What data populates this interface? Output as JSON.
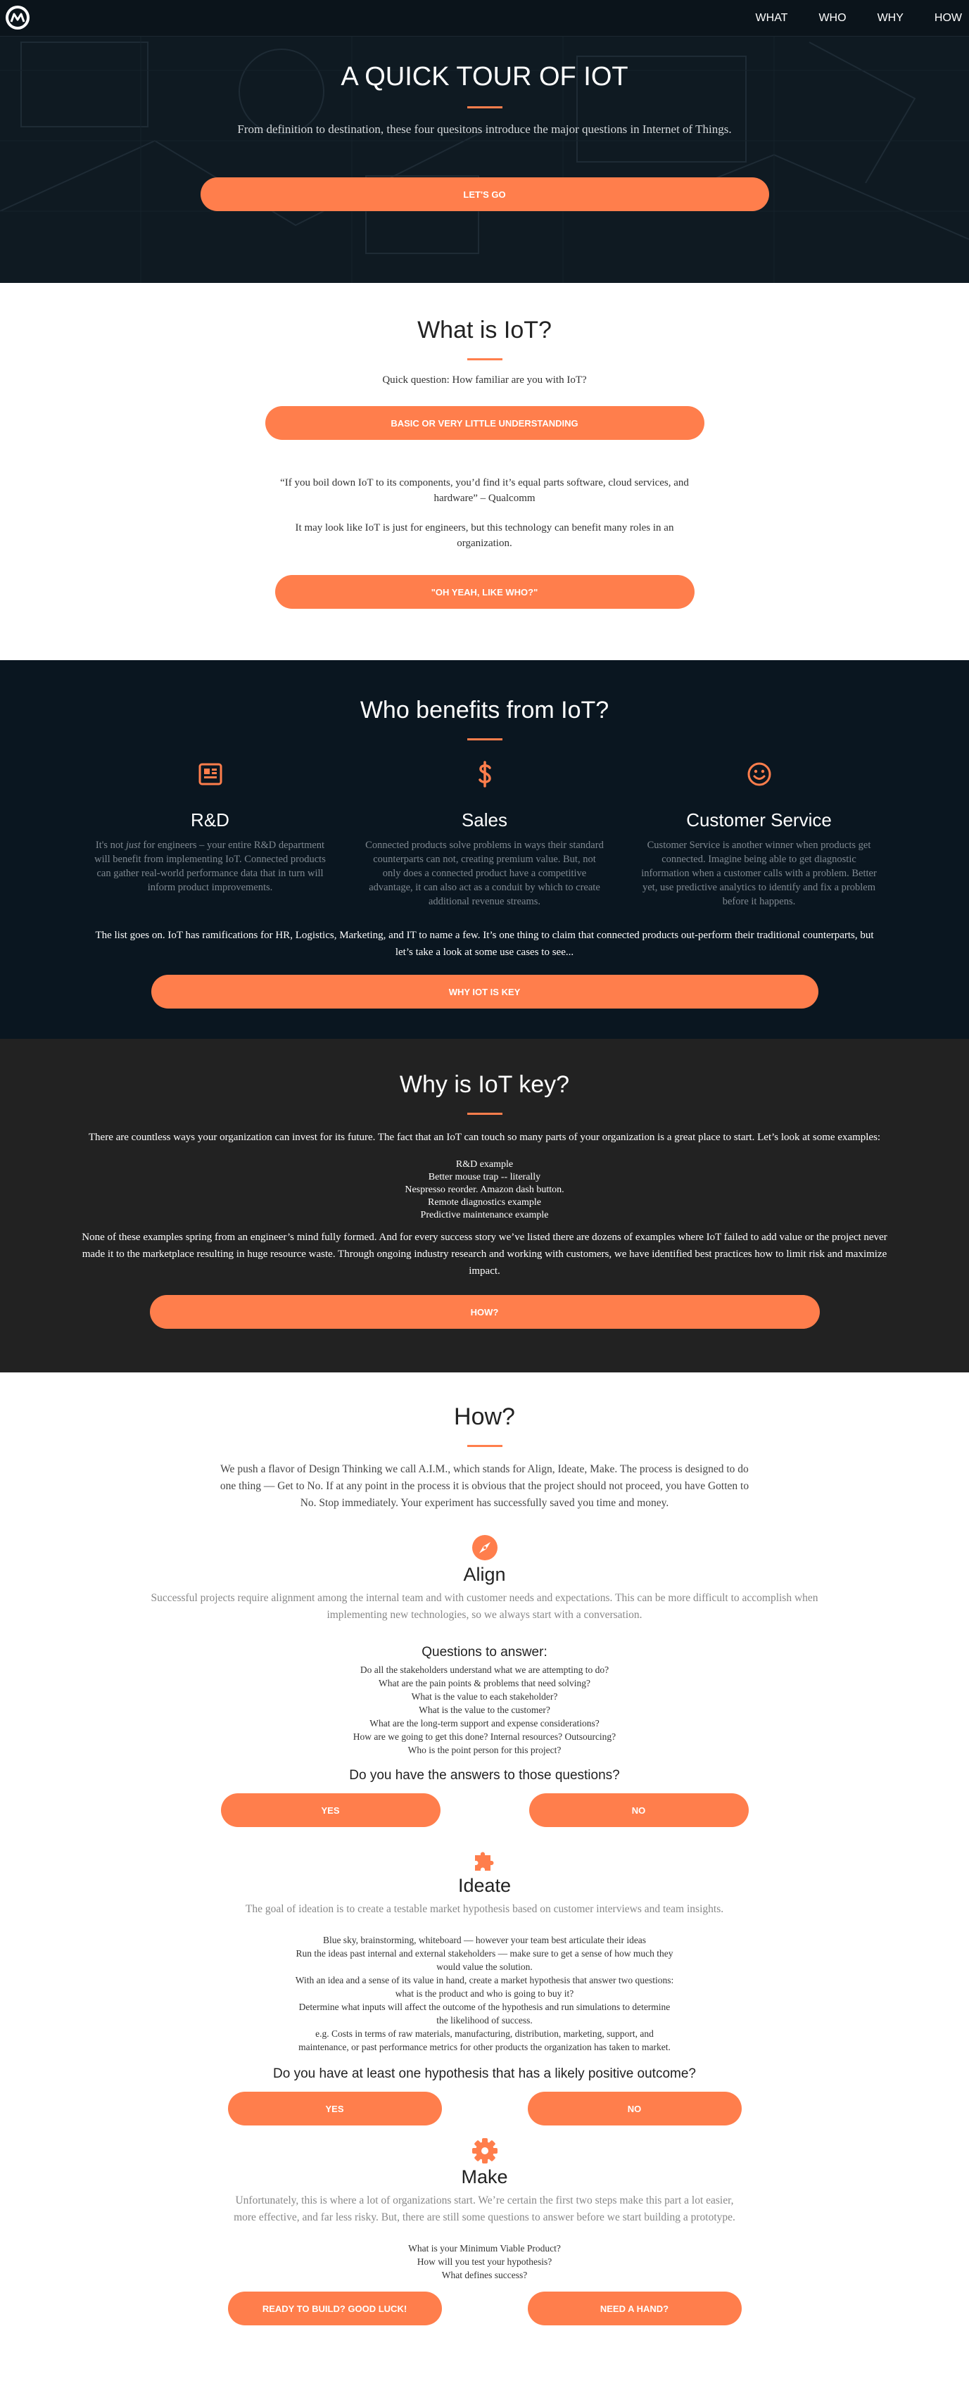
{
  "nav": {
    "links": [
      "WHAT",
      "WHO",
      "WHY",
      "HOW"
    ]
  },
  "hero": {
    "title": "A QUICK TOUR OF IOT",
    "subtitle": "From definition to destination, these four quesitons introduce the major questions in Internet of Things.",
    "button": "LET'S GO"
  },
  "what": {
    "title": "What is IoT?",
    "question": "Quick question: How familiar are you with IoT?",
    "button1": "BASIC OR VERY LITTLE UNDERSTANDING",
    "quote": "“If you boil down IoT to its components, you’d find it’s equal parts software, cloud services, and hardware” – Qualcomm",
    "body": "It may look like IoT is just for engineers, but this technology can benefit many roles in an organization.",
    "button2": "\"OH YEAH, LIKE WHO?\""
  },
  "who": {
    "title": "Who benefits from IoT?",
    "columns": [
      {
        "icon": "newspaper-icon",
        "title": "R&D",
        "text_before": "It's not ",
        "text_em": "just",
        "text_after": " for engineers – your entire R&D department will benefit from implementing IoT. Connected products can gather real-world performance data that in turn will inform product improvements."
      },
      {
        "icon": "dollar-icon",
        "title": "Sales",
        "text_before": "Connected products solve problems in ways their standard counterparts can not, creating premium value. But, not only does a connected product have a competitive advantage, it can also act as a conduit by which to create additional revenue streams.",
        "text_em": "",
        "text_after": ""
      },
      {
        "icon": "smiley-icon",
        "title": "Customer Service",
        "text_before": "Customer Service is another winner when products get connected. Imagine being able to get diagnostic information when a customer calls with a problem. Better yet, use predictive analytics to identify and fix a problem before it happens.",
        "text_em": "",
        "text_after": ""
      }
    ],
    "note": "The list goes on. IoT has ramifications for HR, Logistics, Marketing, and IT to name a few. It’s one thing to claim that connected products out-perform their traditional counterparts, but let’s take a look at some use cases to see...",
    "button": "WHY IOT IS KEY"
  },
  "why": {
    "title": "Why is IoT key?",
    "intro": "There are countless ways your organization can invest for its future. The fact that an IoT can touch so many parts of your organization is a great place to start. Let’s look at some examples:",
    "examples": [
      "R&D example",
      "Better mouse trap -- literally",
      "Nespresso reorder. Amazon dash button.",
      "Remote diagnostics example",
      "Predictive maintenance example"
    ],
    "body": "None of these examples spring from an engineer’s mind fully formed. And for every success story we’ve listed there are dozens of examples where IoT failed to add value or the project never made it to the marketplace resulting in huge resource waste. Through ongoing industry research and working with customers, we have identified best practices how to limit risk and maximize impact.",
    "button": "HOW?"
  },
  "how": {
    "title": "How?",
    "intro": "We push a flavor of Design Thinking we call A.I.M., which stands for Align, Ideate, Make. The process is designed to do one thing — Get to No. If at any point in the process it is obvious that the project should not proceed, you have Gotten to No. Stop immediately. Your experiment has successfully saved you time and money.",
    "align": {
      "icon": "compass-icon",
      "title": "Align",
      "desc": "Successful projects require alignment among the internal team and with customer needs and expectations. This can be more difficult to accomplish when implementing new technologies, so we always start with a conversation.",
      "questions_heading": "Questions to answer:",
      "questions": [
        "Do all the stakeholders understand what we are attempting to do?",
        "What are the pain points & problems that need solving?",
        "What is the value to each stakeholder?",
        "What is the value to the customer?",
        "What are the long-term support and expense considerations?",
        "How are we going to get this done? Internal resources? Outsourcing?",
        "Who is the point person for this project?"
      ],
      "prompt": "Do you have the answers to those questions?",
      "yes": "YES",
      "no": "NO"
    },
    "ideate": {
      "icon": "puzzle-icon",
      "title": "Ideate",
      "desc": "The goal of ideation is to create a testable market hypothesis based on customer interviews and team insights.",
      "items": [
        "Blue sky, brainstorming, whiteboard — however your team best articulate their ideas",
        "Run the ideas past internal and external stakeholders — make sure to get a sense of how much they would value the solution.",
        "With an idea and a sense of its value in hand, create a market hypothesis that answer two questions: what is the product and who is going to buy it?",
        "Determine what inputs will affect the outcome of the hypothesis and run simulations to determine the likelihood of success.",
        "e.g. Costs in terms of raw materials, manufacturing, distribution, marketing, support, and maintenance, or past performance metrics for other products the organization has taken to market."
      ],
      "prompt": "Do you have at least one hypothesis that has a likely positive outcome?",
      "yes": "YES",
      "no": "NO"
    },
    "make": {
      "icon": "gear-icon",
      "title": "Make",
      "desc": "Unfortunately, this is where a lot of organizations start. We’re certain the first two steps make this part a lot easier, more effective, and far less risky. But, there are still some questions to answer before we start building a prototype.",
      "questions": [
        "What is your Minimum Viable Product?",
        "How will you test your hypothesis?",
        "What defines success?"
      ],
      "btn1": "READY TO BUILD? GOOD LUCK!",
      "btn2": "NEED A HAND?"
    }
  },
  "colors": {
    "accent": "#ff7e4c",
    "dark": "#0a1620",
    "charcoal": "#222222"
  }
}
